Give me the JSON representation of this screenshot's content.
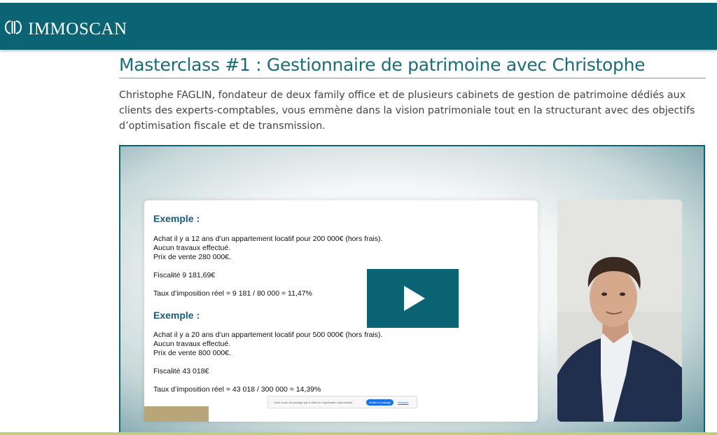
{
  "header": {
    "brand": "IMMOSCAN",
    "brand_icon": "immoscan-logo-icon",
    "background_color": "#0b6474"
  },
  "main": {
    "title": "Masterclass #1 : Gestionnaire de patrimoine avec Christophe",
    "description": "Christophe FAGLIN, fondateur de deux family office et de plusieurs cabinets de gestion de patrimoine dédiés aux clients des experts-comptables, vous emmène dans la vision patrimoniale tout en la structurant avec des objectifs d’optimisation fiscale et de transmission."
  },
  "video": {
    "play_icon": "play-icon",
    "slide": {
      "example1": {
        "title": "Exemple :",
        "line1": "Achat il y a 12 ans d’un appartement locatif pour 200 000€ (hors frais).",
        "line2": "Aucun travaux effectué.",
        "line3": "Prix de vente 280 000€.",
        "fiscalite": "Fiscalité 9 181,69€",
        "taux": "Taux d’imposition réel = 9 181 / 80 000 = 11,47%"
      },
      "example2": {
        "title": "Exemple :",
        "line1": "Achat il y a 20 ans d’un appartement locatif pour 500 000€ (hors frais).",
        "line2": "Aucun travaux effectué.",
        "line3": "Prix de vente 800 000€.",
        "fiscalite": "Fiscalité 43 018€",
        "taux": "Taux d’imposition réel = 43 018 / 300 000 = 14,39%"
      },
      "share_bar": {
        "text": "Votre écran est partagé par le biais de l'application www.default.",
        "stop_button": "Arrêter le partage",
        "hide_link": "Masquer"
      }
    }
  }
}
